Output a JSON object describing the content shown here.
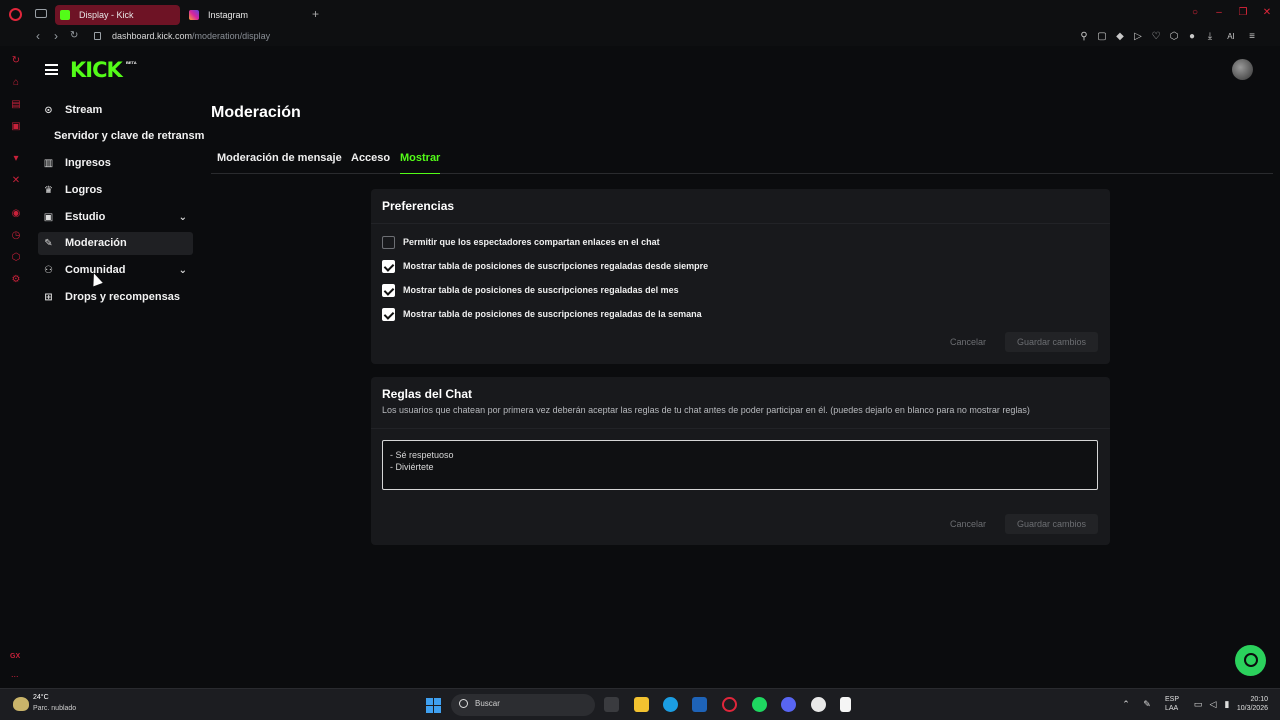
{
  "browser": {
    "tabs": [
      {
        "title": "Display - Kick Dashboard",
        "active": true
      },
      {
        "title": "Instagram",
        "active": false
      }
    ],
    "new_tab": "+",
    "url_host": "dashboard.kick.com",
    "url_path": "/moderation/display",
    "ai_label": "AI"
  },
  "kick": {
    "logo": "KICK",
    "beta": "BETA"
  },
  "nav": {
    "items": [
      {
        "label": "Stream",
        "icon": "stream-icon"
      },
      {
        "label": "Servidor y clave de retransm"
      },
      {
        "label": "Ingresos",
        "icon": "chart-icon"
      },
      {
        "label": "Logros",
        "icon": "trophy-icon"
      },
      {
        "label": "Estudio",
        "icon": "studio-icon",
        "chevron": "⌄"
      },
      {
        "label": "Moderación",
        "icon": "wrench-icon"
      },
      {
        "label": "Comunidad",
        "icon": "community-icon",
        "chevron": "⌄"
      },
      {
        "label": "Drops y recompensas",
        "icon": "gift-icon"
      }
    ]
  },
  "main": {
    "title": "Moderación",
    "tabs": [
      {
        "label": "Moderación de mensaje"
      },
      {
        "label": "Acceso"
      },
      {
        "label": "Mostrar",
        "active": true
      }
    ]
  },
  "preferences": {
    "title": "Preferencias",
    "options": [
      {
        "label": "Permitir que los espectadores compartan enlaces en el chat",
        "checked": false
      },
      {
        "label": "Mostrar tabla de posiciones de suscripciones regaladas desde siempre",
        "checked": true
      },
      {
        "label": "Mostrar tabla de posiciones de suscripciones regaladas del mes",
        "checked": true
      },
      {
        "label": "Mostrar tabla de posiciones de suscripciones regaladas de la semana",
        "checked": true
      }
    ],
    "cancel_label": "Cancelar",
    "save_label": "Guardar cambios"
  },
  "rules": {
    "title": "Reglas del Chat",
    "description": "Los usuarios que chatean por primera vez deberán aceptar las reglas de tu chat antes de poder participar en él. (puedes dejarlo en blanco para no mostrar reglas)",
    "line1": "- Sé respetuoso",
    "line2": "- Diviértete",
    "cancel_label": "Cancelar",
    "save_label": "Guardar cambios"
  },
  "opera": {
    "gx_label": "GX",
    "more": "..."
  },
  "taskbar": {
    "weather_temp": "24°C",
    "weather_desc": "Parc. nublado",
    "search_placeholder": "Buscar",
    "lang_top": "ESP",
    "lang_bottom": "LAA",
    "time": "20:10",
    "date": "10/3/2026"
  },
  "colors": {
    "kick_green": "#53fc18",
    "opera_red": "#e0263b",
    "help_green": "#2bd15c"
  }
}
